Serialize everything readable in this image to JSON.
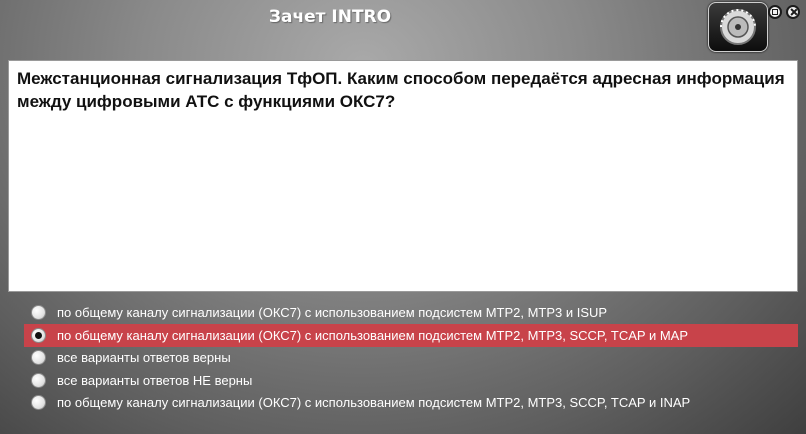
{
  "app": {
    "title": "Зачет INTRO"
  },
  "question": {
    "text": "Межстанционная сигнализация ТфОП. Каким способом передаётся адресная информация между цифровыми АТС с функциями ОКС7?"
  },
  "answers": [
    {
      "label": "по общему каналу сигнализации (ОКС7) с использованием подсистем МТР2, МТР3 и ISUP",
      "selected": false
    },
    {
      "label": "по общему каналу сигнализации (ОКС7) с использованием подсистем МТР2, МТР3, SCCP, TCAP и MAP",
      "selected": true
    },
    {
      "label": "все варианты ответов верны",
      "selected": false
    },
    {
      "label": "все варианты ответов НЕ верны",
      "selected": false
    },
    {
      "label": "по общему каналу сигнализации (ОКС7) с использованием подсистем МТР2, МТР3, SCCP, TCAP и INAP",
      "selected": false
    }
  ],
  "colors": {
    "selected_row": "#c8434a",
    "question_bg": "#ffffff",
    "answer_text": "#ffffff"
  },
  "icons": {
    "logo": "app-logo-icon",
    "minimize": "minimize-icon",
    "close": "close-icon"
  }
}
